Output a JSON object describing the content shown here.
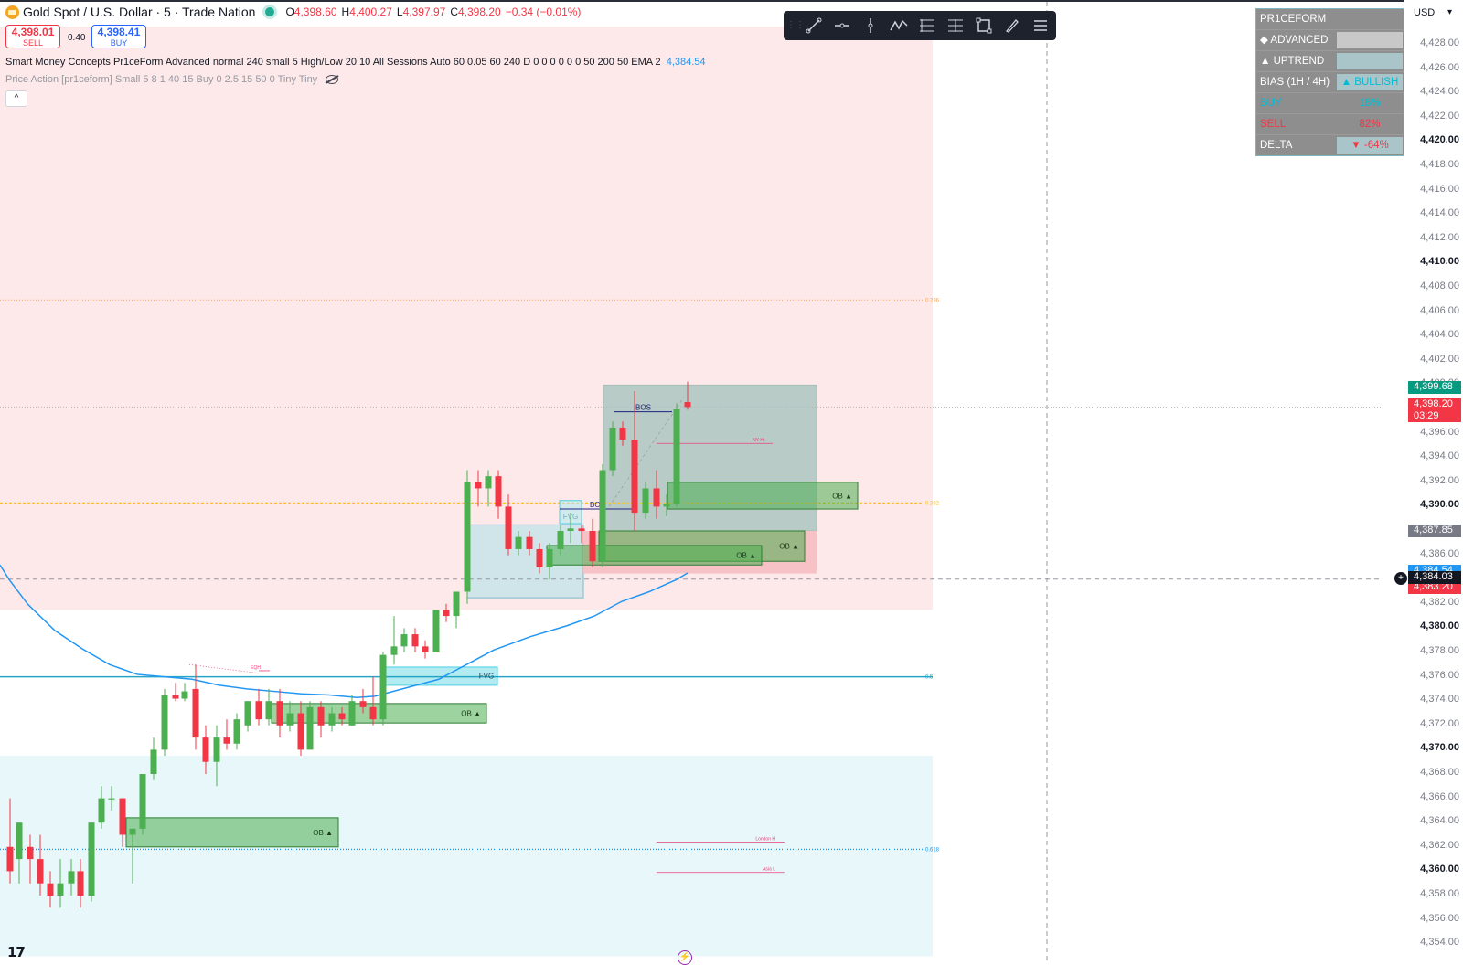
{
  "header": {
    "symbol": "Gold Spot / U.S. Dollar · 5 · Trade Nation",
    "ohlc": [
      {
        "k": "O",
        "v": "4,398.60"
      },
      {
        "k": "H",
        "v": "4,400.27"
      },
      {
        "k": "L",
        "v": "4,397.97"
      },
      {
        "k": "C",
        "v": "4,398.20"
      }
    ],
    "change": "−0.34 (−0.01%)"
  },
  "trade": {
    "sell_price": "4,398.01",
    "sell_label": "SELL",
    "buy_price": "4,398.41",
    "buy_label": "BUY",
    "spread": "0.40"
  },
  "indicators": {
    "smc_text": "Smart Money Concepts Pr1ceForm Advanced normal 240 small 5 High/Low 20 10 All Sessions Auto 60 0.05 60 240 D 0 0 0 0 0 0 50 200 50 EMA 2",
    "smc_value": "4,384.54",
    "pa_text": "Price Action [pr1ceform] Small 5 8 1 40 15 Buy 0 2.5 15 50 0 Tiny Tiny",
    "collapse": "^"
  },
  "toolbar": {
    "grip": "⋮⋮",
    "tools": [
      "trend-line-icon",
      "horizontal-ray-icon",
      "vertical-line-icon",
      "path-icon",
      "long-position-icon",
      "short-position-icon",
      "rectangle-icon",
      "brush-icon",
      "more-menu-icon"
    ]
  },
  "panel": {
    "rows": [
      {
        "l": "PR1CEFORM",
        "r": "",
        "rc": "#ffffff",
        "rbg": "#8e8e8e"
      },
      {
        "l": "◆ ADVANCED",
        "r": "",
        "rc": "#ffffff",
        "rbg": "#c8c8c8"
      },
      {
        "l": "▲ UPTREND",
        "r": "",
        "rc": "#ffffff",
        "rbg": "#a9c5ca"
      },
      {
        "l": "BIAS (1H / 4H)",
        "r": "▲ BULLISH",
        "rc": "#00bcd4",
        "rbg": "#a9c5ca"
      },
      {
        "l": "BUY",
        "r": "18%",
        "rc": "#00bcd4",
        "rbg": "#8e8e8e"
      },
      {
        "l": "SELL",
        "r": "82%",
        "rc": "#f23645",
        "rbg": "#8e8e8e"
      },
      {
        "l": "DELTA",
        "r": "▼ -64%",
        "rc": "#f23645",
        "rbg": "#a9c5ca"
      }
    ],
    "label_colors": [
      "#ffffff",
      "#ffffff",
      "#ffffff",
      "#ffffff",
      "#00bcd4",
      "#f23645",
      "#ffffff"
    ]
  },
  "axis": {
    "currency": "USD",
    "ticks": [
      "4,428.00",
      "4,426.00",
      "4,424.00",
      "4,422.00",
      "4,420.00",
      "4,418.00",
      "4,416.00",
      "4,414.00",
      "4,412.00",
      "4,410.00",
      "4,408.00",
      "4,406.00",
      "4,404.00",
      "4,402.00",
      "4,400.00",
      "4,398.00",
      "4,396.00",
      "4,394.00",
      "4,392.00",
      "4,390.00",
      "4,388.00",
      "4,386.00",
      "4,384.00",
      "4,382.00",
      "4,380.00",
      "4,378.00",
      "4,376.00",
      "4,374.00",
      "4,372.00",
      "4,370.00",
      "4,368.00",
      "4,366.00",
      "4,364.00",
      "4,362.00",
      "4,360.00",
      "4,358.00",
      "4,356.00",
      "4,354.00"
    ],
    "bold_ticks": [
      "4,420.00",
      "4,410.00",
      "4,390.00",
      "4,380.00",
      "4,370.00",
      "4,360.00"
    ],
    "price_tags": [
      {
        "price": 4399.68,
        "text": "4,399.68",
        "bg": "#089981"
      },
      {
        "price": 4398.2,
        "text": "4,398.20",
        "sub": "03:29",
        "bg": "#f23645"
      },
      {
        "price": 4387.85,
        "text": "4,387.85",
        "bg": "#787b86"
      },
      {
        "price": 4384.54,
        "text": "4,384.54",
        "bg": "#2196f3"
      },
      {
        "price": 4383.2,
        "text": "4,383.20",
        "bg": "#f23645"
      },
      {
        "price": 4384.03,
        "text": "4,384.03",
        "bg": "#131722"
      }
    ]
  },
  "chart_data": {
    "type": "candlestick",
    "y_range": [
      4353,
      4429.5
    ],
    "candles": [
      {
        "o": 4362,
        "h": 4366,
        "l": 4359,
        "c": 4360,
        "x": 11
      },
      {
        "o": 4361,
        "h": 4364,
        "l": 4359,
        "c": 4364,
        "x": 21
      },
      {
        "o": 4362,
        "h": 4363,
        "l": 4359,
        "c": 4361,
        "x": 33
      },
      {
        "o": 4361,
        "h": 4363,
        "l": 4358,
        "c": 4359,
        "x": 44
      },
      {
        "o": 4359,
        "h": 4360,
        "l": 4357,
        "c": 4358,
        "x": 55
      },
      {
        "o": 4358,
        "h": 4361,
        "l": 4357,
        "c": 4359,
        "x": 66
      },
      {
        "o": 4359,
        "h": 4361,
        "l": 4358,
        "c": 4360,
        "x": 78
      },
      {
        "o": 4360,
        "h": 4361,
        "l": 4357,
        "c": 4358,
        "x": 88
      },
      {
        "o": 4358,
        "h": 4364,
        "l": 4357.5,
        "c": 4364,
        "x": 100
      },
      {
        "o": 4364,
        "h": 4367,
        "l": 4363.5,
        "c": 4366,
        "x": 111
      },
      {
        "o": 4366,
        "h": 4367,
        "l": 4365,
        "c": 4366,
        "x": 122
      },
      {
        "o": 4366,
        "h": 4366,
        "l": 4362,
        "c": 4363,
        "x": 134
      },
      {
        "o": 4363,
        "h": 4363.5,
        "l": 4359,
        "c": 4363.5,
        "x": 145
      },
      {
        "o": 4363.5,
        "h": 4368,
        "l": 4363,
        "c": 4368,
        "x": 156
      },
      {
        "o": 4368,
        "h": 4371,
        "l": 4367.5,
        "c": 4370,
        "x": 168
      },
      {
        "o": 4370,
        "h": 4375,
        "l": 4369.5,
        "c": 4374.5,
        "x": 180
      },
      {
        "o": 4374.5,
        "h": 4375.5,
        "l": 4374,
        "c": 4374.2,
        "x": 192
      },
      {
        "o": 4374.2,
        "h": 4375.5,
        "l": 4374,
        "c": 4374.8,
        "x": 202
      },
      {
        "o": 4375,
        "h": 4377,
        "l": 4370,
        "c": 4371,
        "x": 214
      },
      {
        "o": 4371,
        "h": 4372,
        "l": 4368,
        "c": 4369,
        "x": 225
      },
      {
        "o": 4369,
        "h": 4372,
        "l": 4367,
        "c": 4371,
        "x": 237
      },
      {
        "o": 4371,
        "h": 4372.5,
        "l": 4370,
        "c": 4370.5,
        "x": 248
      },
      {
        "o": 4370.5,
        "h": 4373,
        "l": 4370,
        "c": 4372.5,
        "x": 259
      },
      {
        "o": 4372,
        "h": 4374,
        "l": 4371.5,
        "c": 4374,
        "x": 271
      },
      {
        "o": 4374,
        "h": 4375,
        "l": 4372,
        "c": 4372.5,
        "x": 283
      },
      {
        "o": 4372.5,
        "h": 4375,
        "l": 4372,
        "c": 4374,
        "x": 294
      },
      {
        "o": 4374,
        "h": 4375,
        "l": 4371,
        "c": 4372,
        "x": 306
      },
      {
        "o": 4372,
        "h": 4374,
        "l": 4371.5,
        "c": 4373,
        "x": 317
      },
      {
        "o": 4373,
        "h": 4374,
        "l": 4369.5,
        "c": 4370,
        "x": 329
      },
      {
        "o": 4370,
        "h": 4374,
        "l": 4370,
        "c": 4373.5,
        "x": 339
      },
      {
        "o": 4373.5,
        "h": 4374,
        "l": 4371,
        "c": 4372,
        "x": 351
      },
      {
        "o": 4372,
        "h": 4373.5,
        "l": 4371.5,
        "c": 4373,
        "x": 363
      },
      {
        "o": 4373,
        "h": 4373.5,
        "l": 4372,
        "c": 4372.5,
        "x": 374
      },
      {
        "o": 4372,
        "h": 4374.5,
        "l": 4372,
        "c": 4374,
        "x": 385
      },
      {
        "o": 4374,
        "h": 4375,
        "l": 4373,
        "c": 4373.5,
        "x": 397
      },
      {
        "o": 4373.5,
        "h": 4376,
        "l": 4372,
        "c": 4372.5,
        "x": 408
      },
      {
        "o": 4372.5,
        "h": 4378,
        "l": 4372,
        "c": 4377.8,
        "x": 419
      },
      {
        "o": 4377.8,
        "h": 4381,
        "l": 4377,
        "c": 4378.5,
        "x": 431
      },
      {
        "o": 4378.5,
        "h": 4380,
        "l": 4378,
        "c": 4379.5,
        "x": 442
      },
      {
        "o": 4379.5,
        "h": 4380,
        "l": 4378,
        "c": 4378.5,
        "x": 454
      },
      {
        "o": 4378.5,
        "h": 4379,
        "l": 4377.5,
        "c": 4378,
        "x": 465
      },
      {
        "o": 4378,
        "h": 4381.5,
        "l": 4378,
        "c": 4381.5,
        "x": 477
      },
      {
        "o": 4381.5,
        "h": 4382,
        "l": 4380.5,
        "c": 4381,
        "x": 488
      },
      {
        "o": 4381,
        "h": 4383,
        "l": 4380,
        "c": 4383,
        "x": 499
      },
      {
        "o": 4383,
        "h": 4393,
        "l": 4382,
        "c": 4392,
        "x": 511
      },
      {
        "o": 4392,
        "h": 4393,
        "l": 4390,
        "c": 4391.5,
        "x": 523
      },
      {
        "o": 4391.5,
        "h": 4393,
        "l": 4390,
        "c": 4392.5,
        "x": 534
      },
      {
        "o": 4392.5,
        "h": 4393,
        "l": 4389,
        "c": 4390,
        "x": 545
      },
      {
        "o": 4390,
        "h": 4391,
        "l": 4386,
        "c": 4386.5,
        "x": 556
      },
      {
        "o": 4386.5,
        "h": 4388,
        "l": 4386,
        "c": 4387.5,
        "x": 567
      },
      {
        "o": 4387.5,
        "h": 4388,
        "l": 4386,
        "c": 4386.5,
        "x": 579
      },
      {
        "o": 4386.5,
        "h": 4387,
        "l": 4384.5,
        "c": 4385,
        "x": 590
      },
      {
        "o": 4385,
        "h": 4387,
        "l": 4384,
        "c": 4386.5,
        "x": 601
      },
      {
        "o": 4386.5,
        "h": 4388.5,
        "l": 4386,
        "c": 4388,
        "x": 613
      },
      {
        "o": 4388,
        "h": 4389.5,
        "l": 4387,
        "c": 4388.2,
        "x": 624
      },
      {
        "o": 4388.2,
        "h": 4388.5,
        "l": 4387,
        "c": 4388,
        "x": 636
      },
      {
        "o": 4388,
        "h": 4389,
        "l": 4385,
        "c": 4385.5,
        "x": 648
      },
      {
        "o": 4385.5,
        "h": 4393.5,
        "l": 4385,
        "c": 4393,
        "x": 659
      },
      {
        "o": 4393,
        "h": 4397,
        "l": 4392.5,
        "c": 4396.5,
        "x": 670
      },
      {
        "o": 4396.5,
        "h": 4397,
        "l": 4395,
        "c": 4395.5,
        "x": 681
      },
      {
        "o": 4395.5,
        "h": 4399.5,
        "l": 4388,
        "c": 4389.5,
        "x": 694
      },
      {
        "o": 4389.5,
        "h": 4392,
        "l": 4389,
        "c": 4391.5,
        "x": 706
      },
      {
        "o": 4391.5,
        "h": 4393,
        "l": 4389,
        "c": 4390,
        "x": 718
      },
      {
        "o": 4390,
        "h": 4391,
        "l": 4389.2,
        "c": 4390.2,
        "x": 729
      },
      {
        "o": 4390.2,
        "h": 4398.5,
        "l": 4390,
        "c": 4398,
        "x": 740
      },
      {
        "o": 4398.6,
        "h": 4400.27,
        "l": 4397.97,
        "c": 4398.2,
        "x": 752
      }
    ],
    "ema": [
      [
        0,
        4385.2
      ],
      [
        10,
        4384
      ],
      [
        30,
        4382
      ],
      [
        60,
        4379.8
      ],
      [
        90,
        4378.3
      ],
      [
        120,
        4377
      ],
      [
        150,
        4376.2
      ],
      [
        180,
        4376
      ],
      [
        210,
        4375.8
      ],
      [
        240,
        4375.3
      ],
      [
        270,
        4375
      ],
      [
        300,
        4374.8
      ],
      [
        330,
        4374.6
      ],
      [
        360,
        4374.5
      ],
      [
        390,
        4374.3
      ],
      [
        410,
        4374.4
      ],
      [
        440,
        4375
      ],
      [
        480,
        4375.8
      ],
      [
        510,
        4377
      ],
      [
        540,
        4378.2
      ],
      [
        580,
        4379.3
      ],
      [
        620,
        4380.2
      ],
      [
        650,
        4381
      ],
      [
        680,
        4382.2
      ],
      [
        710,
        4383
      ],
      [
        740,
        4384
      ],
      [
        752,
        4384.54
      ]
    ],
    "zones": [
      {
        "kind": "premium",
        "x1": 0,
        "x2": 1020,
        "p1": 4429.5,
        "p2": 4381.5,
        "fill": "#fde9e9",
        "stroke": "none"
      },
      {
        "kind": "discount",
        "x1": 0,
        "x2": 1020,
        "p1": 4369.5,
        "p2": 4353,
        "fill": "#e7f7fa",
        "stroke": "none"
      },
      {
        "kind": "fvg",
        "x1": 511,
        "x2": 638,
        "p1": 4388.5,
        "p2": 4382.5,
        "fill": "#cfe5e9",
        "stroke": "#80b8cc"
      },
      {
        "kind": "fvg-dark",
        "x1": 660,
        "x2": 893,
        "p1": 4400,
        "p2": 4388,
        "fill": "#b9cbc7",
        "stroke": "#a6bcb8"
      },
      {
        "kind": "ob-red",
        "x1": 638,
        "x2": 893,
        "p1": 4388,
        "p2": 4384.5,
        "fill": "#f6c2c6",
        "stroke": "none"
      },
      {
        "kind": "fvg-mid",
        "x1": 420,
        "x2": 544,
        "p1": 4376.8,
        "p2": 4375.3,
        "fill": "#b2ebf2",
        "stroke": "#4dd0e1"
      }
    ],
    "blocks": [
      {
        "x1": 730,
        "x2": 938,
        "p1": 4392,
        "p2": 4389.8,
        "label": "OB ▲"
      },
      {
        "x1": 655,
        "x2": 880,
        "p1": 4388,
        "p2": 4385.5,
        "label": "OB ▲"
      },
      {
        "x1": 598,
        "x2": 833,
        "p1": 4386.8,
        "p2": 4385.2,
        "label": "OB ▲"
      },
      {
        "x1": 297,
        "x2": 532,
        "p1": 4373.8,
        "p2": 4372.2,
        "label": "OB ▲"
      },
      {
        "x1": 138,
        "x2": 370,
        "p1": 4364.4,
        "p2": 4362,
        "label": "OB ▲"
      }
    ],
    "fvg_labels": [
      {
        "x": 532,
        "p": 4376.1,
        "text": "FVG"
      },
      {
        "x": 624,
        "p": 4389.2,
        "text": "FVG"
      }
    ],
    "bos": [
      {
        "x1": 672,
        "x2": 735,
        "p": 4397.8,
        "text": "BOS"
      },
      {
        "x1": 612,
        "x2": 695,
        "p": 4389.8,
        "text": "BOS"
      }
    ],
    "hlines": [
      {
        "p": 4407,
        "x1": 0,
        "x2": 1010,
        "color": "#f7a35c",
        "dash": "1,2",
        "w": 1,
        "label": "0.236"
      },
      {
        "p": 4390.3,
        "x1": 0,
        "x2": 1010,
        "color": "#fbc02d",
        "dash": "3,2",
        "w": 1.3,
        "label": "0.382"
      },
      {
        "p": 4376,
        "x1": 0,
        "x2": 1020,
        "color": "#26a6c4",
        "dash": "",
        "w": 1.5,
        "label": "0.5"
      },
      {
        "p": 4361.8,
        "x1": 0,
        "x2": 1010,
        "color": "#2196f3",
        "dash": "1,2",
        "w": 1.3,
        "label": "0.618"
      },
      {
        "p": 4398.2,
        "x1": 0,
        "x2": 1535,
        "color": "#b2b5be",
        "dash": "1,2",
        "w": 1,
        "label": ""
      },
      {
        "p": 4384.03,
        "x1": 0,
        "x2": 1525,
        "color": "#9598a1",
        "dash": "5,4",
        "w": 1,
        "label": ""
      }
    ],
    "session_lines": [
      {
        "x1": 718,
        "x2": 845,
        "p": 4395.2,
        "text": "NY H"
      },
      {
        "x1": 718,
        "x2": 858,
        "p": 4362.4,
        "text": "London H"
      },
      {
        "x1": 718,
        "x2": 858,
        "p": 4359.9,
        "text": "Asia L"
      },
      {
        "x1": 283,
        "x2": 295,
        "p": 4376.5,
        "text": "EQH"
      }
    ],
    "crosshair_x": 1145
  }
}
